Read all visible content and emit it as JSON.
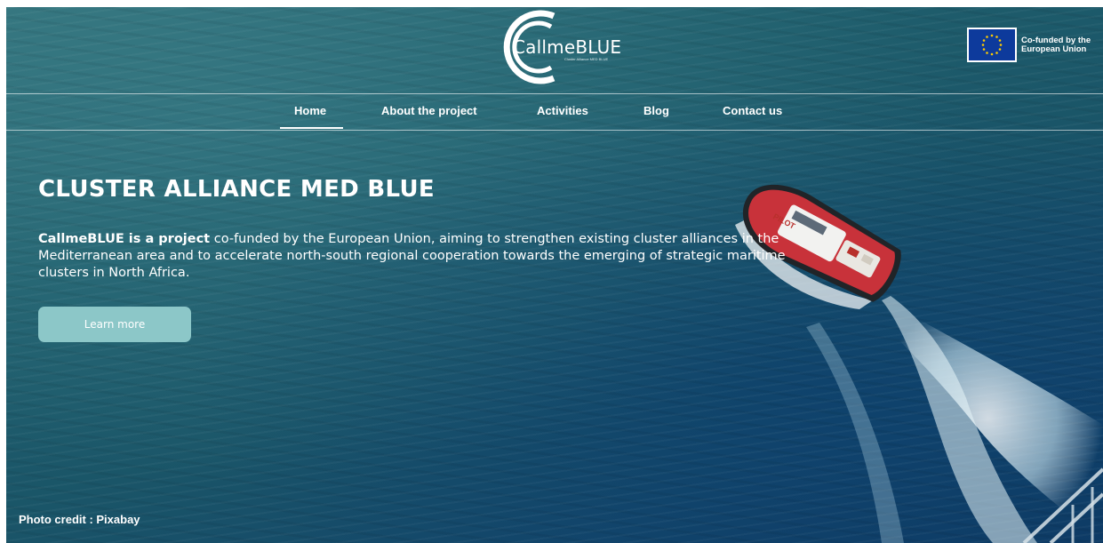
{
  "logo": {
    "text": "CallmeBLUE",
    "tagline": "Cluster Alliance MED BLUE"
  },
  "eu_badge": {
    "text": "Co-funded by the European Union"
  },
  "nav": {
    "items": [
      {
        "label": "Home",
        "active": true
      },
      {
        "label": "About the project",
        "active": false
      },
      {
        "label": "Activities",
        "active": false
      },
      {
        "label": "Blog",
        "active": false
      },
      {
        "label": "Contact us",
        "active": false
      }
    ]
  },
  "hero": {
    "title": "CLUSTER ALLIANCE MED BLUE",
    "desc_bold": "CallmeBLUE is a project",
    "desc_rest": " co-funded by the European Union, aiming to strengthen existing cluster alliances in the Mediterranean area and to accelerate north-south regional cooperation towards the emerging of strategic maritime clusters in North Africa.",
    "button_label": "Learn more",
    "boat_label": "PILOT"
  },
  "footer": {
    "credit": "Photo credit : Pixabay"
  },
  "colors": {
    "sea_dark": "#0e3a63",
    "sea_teal": "#2f6f78",
    "button": "#8cc7c8",
    "eu_flag": "#0d3a9c",
    "eu_star": "#ffcc00",
    "boat_red": "#c8323a"
  }
}
